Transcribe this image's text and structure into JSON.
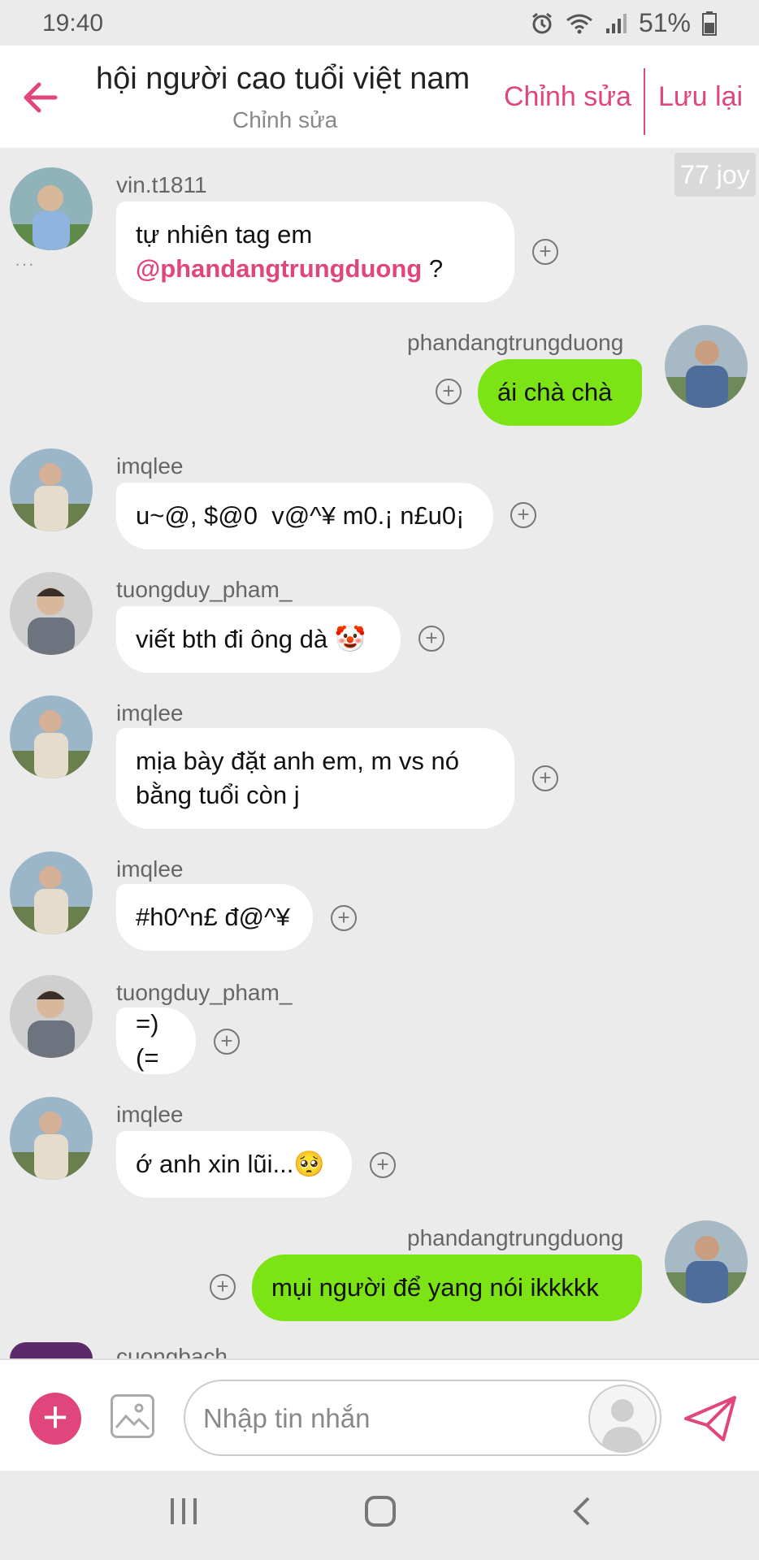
{
  "status_bar": {
    "time": "19:40",
    "battery": "51%"
  },
  "header": {
    "title": "hội người cao tuổi việt nam",
    "subtitle": "Chỉnh sửa",
    "edit_label": "Chỉnh sửa",
    "save_label": "Lưu lại"
  },
  "badge": {
    "joy": "77 joy"
  },
  "messages": [
    {
      "user": "vin.t1811",
      "side": "left",
      "text_line1": "tự nhiên tag em",
      "mention": "@phandangtrungduong",
      "text_suffix": " ?"
    },
    {
      "user": "phandangtrungduong",
      "side": "right",
      "text": "ái chà chà"
    },
    {
      "user": "imqlee",
      "side": "left",
      "text": "u~@, $@0  v@^¥ m0.¡ n£u0¡"
    },
    {
      "user": "tuongduy_pham_",
      "side": "left",
      "text": "viết bth đi ông dà 🤡"
    },
    {
      "user": "imqlee",
      "side": "left",
      "text_line1": "mịa bày đặt anh em, m vs nó",
      "text_line2": "bằng tuổi còn j"
    },
    {
      "user": "imqlee",
      "side": "left",
      "text": "#h0^n£ đ@^¥"
    },
    {
      "user": "tuongduy_pham_",
      "side": "left",
      "text": "=)(="
    },
    {
      "user": "imqlee",
      "side": "left",
      "text": "ớ anh xin lũi...🥺"
    },
    {
      "user": "phandangtrungduong",
      "side": "right",
      "text": "mụi người để yang nói ikkkkk"
    },
    {
      "user": "cuongbach",
      "side": "left",
      "partial": true
    }
  ],
  "composer": {
    "placeholder": "Nhập tin nhắn"
  },
  "colors": {
    "accent": "#e0457b",
    "own_bubble": "#7ce314",
    "background": "#ebebeb"
  }
}
